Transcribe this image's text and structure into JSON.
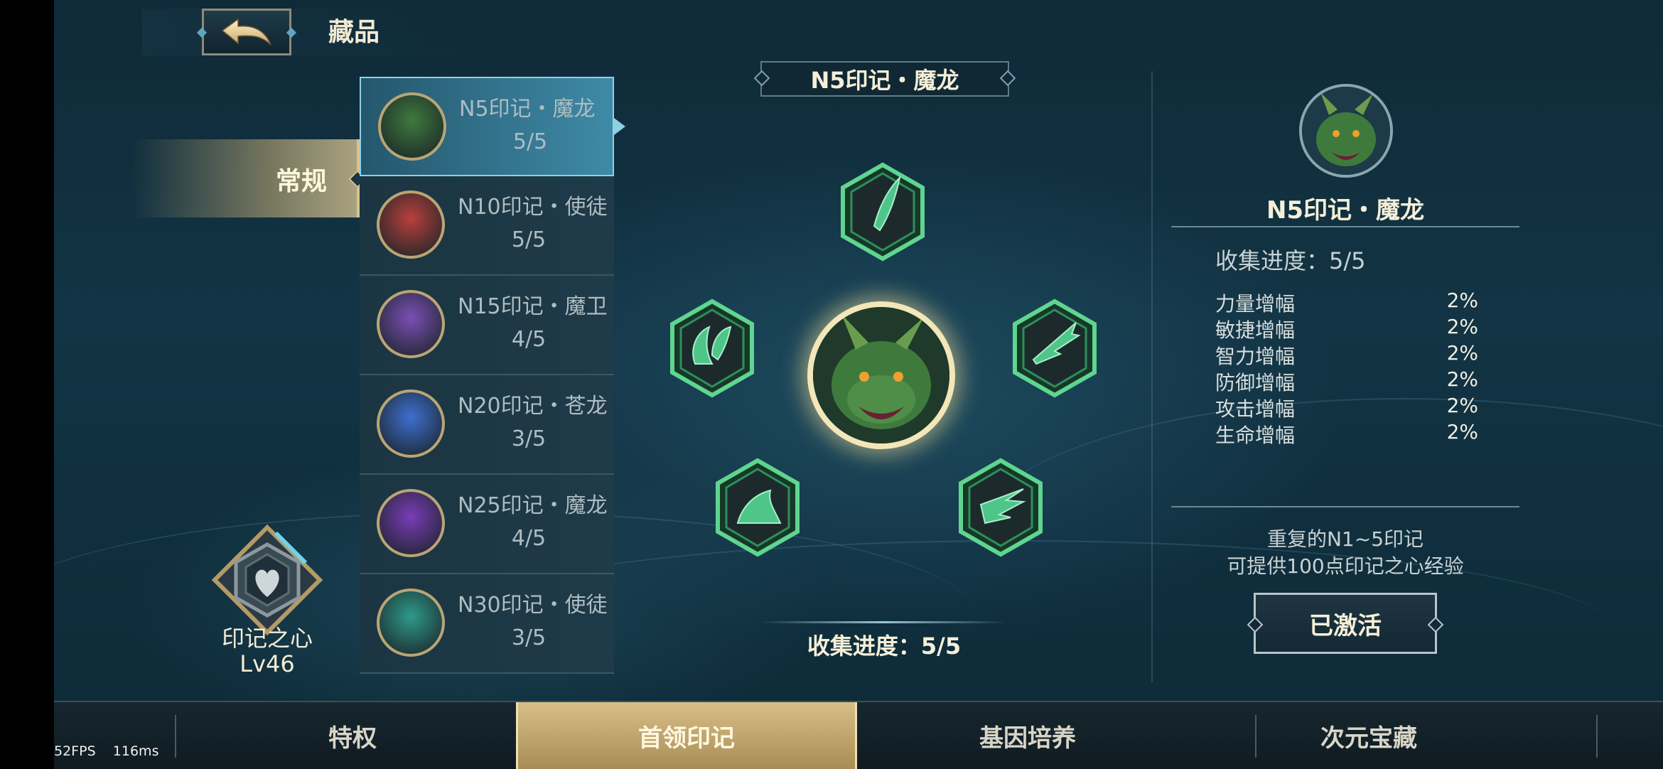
{
  "header": {
    "title": "藏品",
    "back_icon": "back-arrow-icon"
  },
  "category_tab": {
    "label": "常规"
  },
  "mark_list": [
    {
      "name": "N5印记・魔龙",
      "count": "5/5",
      "avatar_color": "#3f7a3d",
      "selected": true
    },
    {
      "name": "N10印记・使徒",
      "count": "5/5",
      "avatar_color": "#b8403c",
      "selected": false
    },
    {
      "name": "N15印记・魔卫",
      "count": "4/5",
      "avatar_color": "#7b4fb5",
      "selected": false
    },
    {
      "name": "N20印记・苍龙",
      "count": "3/5",
      "avatar_color": "#3f6fd0",
      "selected": false
    },
    {
      "name": "N25印记・魔龙",
      "count": "4/5",
      "avatar_color": "#7a3cb8",
      "selected": false
    },
    {
      "name": "N30印记・使徒",
      "count": "3/5",
      "avatar_color": "#2f9a8a",
      "selected": false
    }
  ],
  "heart": {
    "label": "印记之心",
    "level": "Lv46",
    "icon": "heart-icon"
  },
  "center": {
    "title": "N5印记・魔龙",
    "progress": "收集进度：5/5",
    "fragments": [
      "horn-fragment-icon",
      "claw-fragment-icon",
      "wing-fragment-icon",
      "leg-fragment-icon",
      "tail-fragment-icon"
    ]
  },
  "detail": {
    "name": "N5印记・魔龙",
    "progress": "收集进度：5/5",
    "stats": [
      {
        "name": "力量增幅",
        "value": "2%"
      },
      {
        "name": "敏捷增幅",
        "value": "2%"
      },
      {
        "name": "智力增幅",
        "value": "2%"
      },
      {
        "name": "防御增幅",
        "value": "2%"
      },
      {
        "name": "攻击增幅",
        "value": "2%"
      },
      {
        "name": "生命增幅",
        "value": "2%"
      }
    ],
    "note_line1": "重复的N1~5印记",
    "note_line2": "可提供100点印记之心经验",
    "button": "已激活"
  },
  "bottom_tabs": [
    {
      "label": "特权",
      "active": false
    },
    {
      "label": "首领印记",
      "active": true
    },
    {
      "label": "基因培养",
      "active": false
    },
    {
      "label": "次元宝藏",
      "active": false
    }
  ],
  "overlay": {
    "fps": "52FPS",
    "latency": "116ms"
  },
  "colors": {
    "accent_gold": "#d8bf86",
    "hex_green": "#5fd58f",
    "panel_blue": "#1f3a48"
  }
}
